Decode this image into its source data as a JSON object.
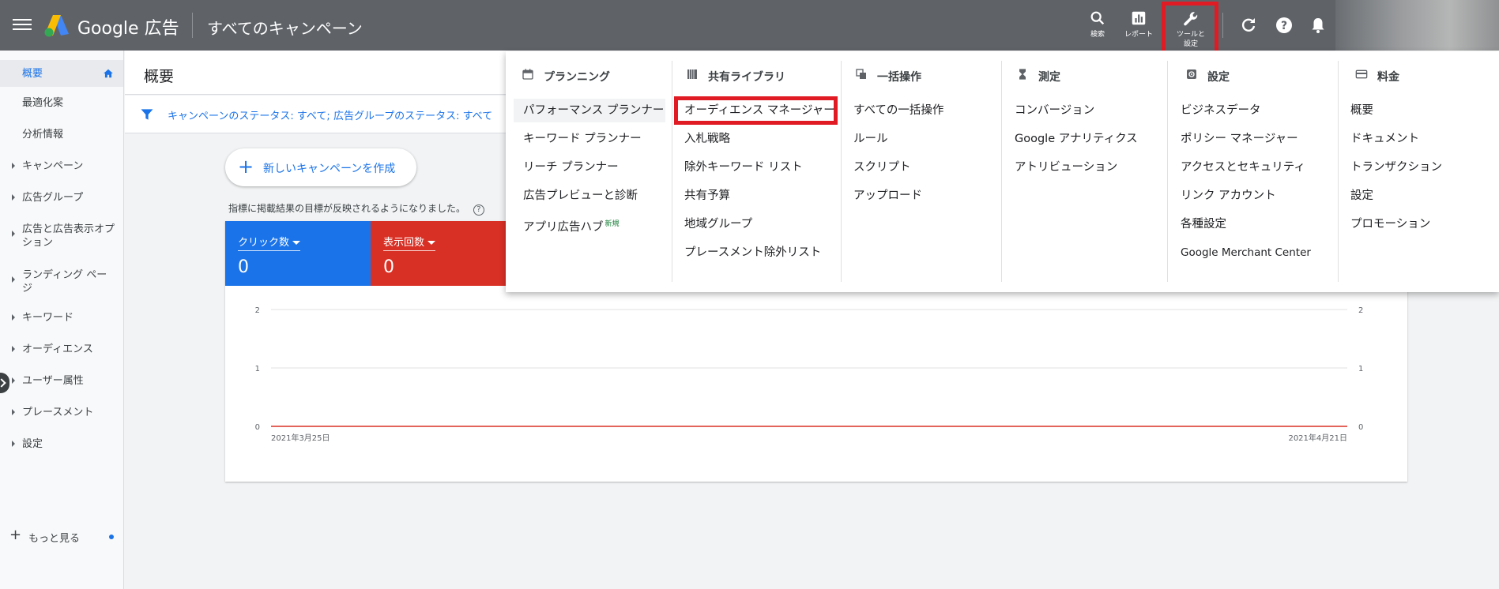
{
  "header": {
    "brand": "Google 広告",
    "view_title": "すべてのキャンペーン",
    "icons": [
      {
        "name": "search",
        "label": "検索"
      },
      {
        "name": "report",
        "label": "レポート"
      },
      {
        "name": "tools",
        "label": "ツールと設定"
      }
    ],
    "round_icons": [
      "refresh-icon",
      "help-icon",
      "bell-icon"
    ],
    "highlight_color": "#e01b24"
  },
  "sidebar": {
    "items": [
      {
        "label": "概要",
        "active": true
      },
      {
        "label": "最適化案"
      },
      {
        "label": "分析情報"
      },
      {
        "label": "キャンペーン",
        "expandable": true
      },
      {
        "label": "広告グループ",
        "expandable": true
      },
      {
        "label": "広告と広告表示オプション",
        "expandable": true
      },
      {
        "label": "ランディング ページ",
        "expandable": true
      },
      {
        "label": "キーワード",
        "expandable": true
      },
      {
        "label": "オーディエンス",
        "expandable": true
      },
      {
        "label": "ユーザー属性",
        "expandable": true
      },
      {
        "label": "プレースメント",
        "expandable": true
      },
      {
        "label": "設定",
        "expandable": true
      }
    ],
    "more_label": "もっと見る"
  },
  "page": {
    "title": "概要",
    "filter_text": "キャンペーンのステータス: すべて; 広告グループのステータス: すべて",
    "new_campaign_label": "新しいキャンペーンを作成",
    "notice": "指標に掲載結果の目標が反映されるようになりました。",
    "notice_help": "?"
  },
  "metrics": [
    {
      "label": "クリック数",
      "value": "0",
      "color": "#1a73e8"
    },
    {
      "label": "表示回数",
      "value": "0",
      "color": "#d93025"
    }
  ],
  "chart_data": {
    "type": "line",
    "x": [
      "2021年3月25日",
      "2021年4月21日"
    ],
    "x_tick_labels": [
      "2021年3月25日",
      "2021年4月21日"
    ],
    "series": [
      {
        "values": [
          0,
          0
        ],
        "color": "#d93025"
      }
    ],
    "y_ticks": [
      0,
      1,
      2
    ],
    "ylim": [
      0,
      2
    ],
    "grid": true
  },
  "tools_menu": {
    "columns": [
      {
        "heading": "プランニング",
        "icon": "calendar-icon",
        "items": [
          "パフォーマンス プランナー",
          "キーワード プランナー",
          "リーチ プランナー",
          "広告プレビューと診断",
          "アプリ広告ハブ"
        ],
        "badge": "新規"
      },
      {
        "heading": "共有ライブラリ",
        "icon": "library-icon",
        "items": [
          "オーディエンス マネージャー",
          "入札戦略",
          "除外キーワード リスト",
          "共有予算",
          "地域グループ",
          "プレースメント除外リスト"
        ]
      },
      {
        "heading": "一括操作",
        "icon": "bulk-copy-icon",
        "items": [
          "すべての一括操作",
          "ルール",
          "スクリプト",
          "アップロード"
        ]
      },
      {
        "heading": "測定",
        "icon": "hourglass-icon",
        "items": [
          "コンバージョン",
          "Google アナリティクス",
          "アトリビューション"
        ]
      },
      {
        "heading": "設定",
        "icon": "gear-icon",
        "items": [
          "ビジネスデータ",
          "ポリシー マネージャー",
          "アクセスとセキュリティ",
          "リンク アカウント",
          "各種設定",
          "Google Merchant Center"
        ]
      },
      {
        "heading": "料金",
        "icon": "credit-card-icon",
        "items": [
          "概要",
          "ドキュメント",
          "トランザクション",
          "設定",
          "プロモーション"
        ]
      }
    ]
  }
}
